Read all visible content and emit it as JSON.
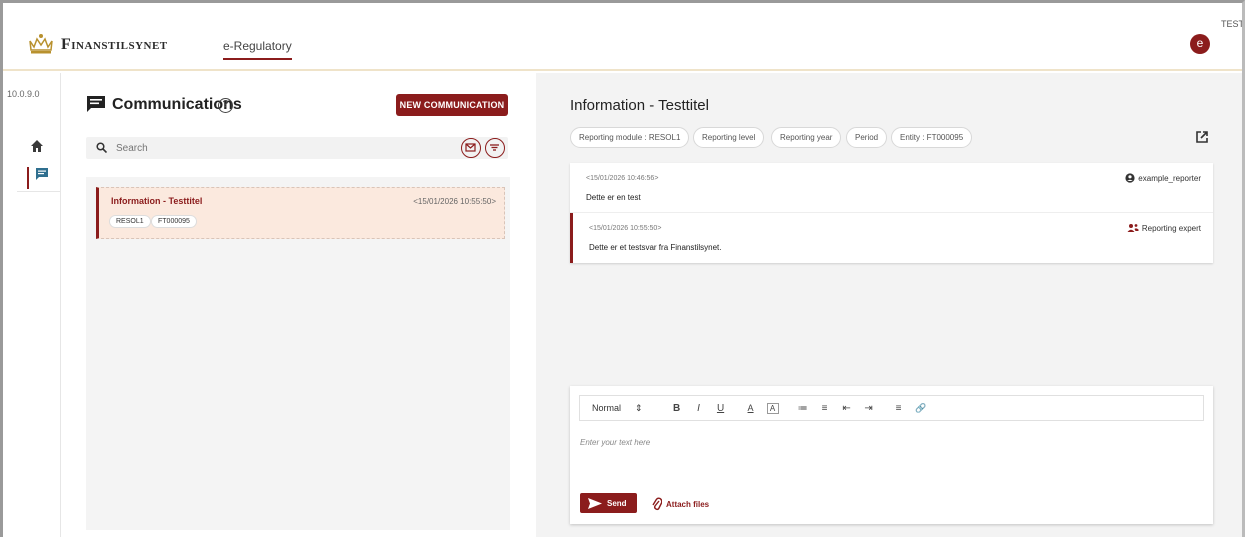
{
  "header": {
    "brand": "Finanstilsynet",
    "nav_link": "e-Regulatory",
    "env_label": "TEST",
    "avatar_initial": "e"
  },
  "rail": {
    "version": "10.0.9.0"
  },
  "communications": {
    "title": "Communications",
    "help": "?",
    "new_button": "NEW COMMUNICATION",
    "search_placeholder": "Search",
    "items": [
      {
        "title": "Information - Testtitel",
        "date": "<15/01/2026 10:55:50>",
        "tags": [
          "RESOL1",
          "FT000095"
        ]
      }
    ]
  },
  "detail": {
    "title": "Information - Testtitel",
    "chips": [
      "Reporting module : RESOL1",
      "Reporting level",
      "Reporting year",
      "Period",
      "Entity : FT000095"
    ],
    "messages": [
      {
        "timestamp": "<15/01/2026 10:46:56>",
        "body": "Dette er en test",
        "author": "example_reporter"
      },
      {
        "timestamp": "<15/01/2026 10:55:50>",
        "body": "Dette er et testsvar fra Finanstilsynet.",
        "author": "Reporting expert"
      }
    ]
  },
  "editor": {
    "format_select": "Normal",
    "format_arrows": "⇕",
    "toolbar": [
      "B",
      "I",
      "U",
      "A",
      "A",
      "≔",
      "≡",
      "⇤",
      "⇥",
      "≡",
      "🔗"
    ],
    "placeholder": "Enter your text here",
    "send_label": "Send",
    "attach_label": "Attach files"
  },
  "colors": {
    "accent": "#8b1c1c",
    "selected_bg": "#fbe9de",
    "panel_bg": "#f3f3f3"
  }
}
